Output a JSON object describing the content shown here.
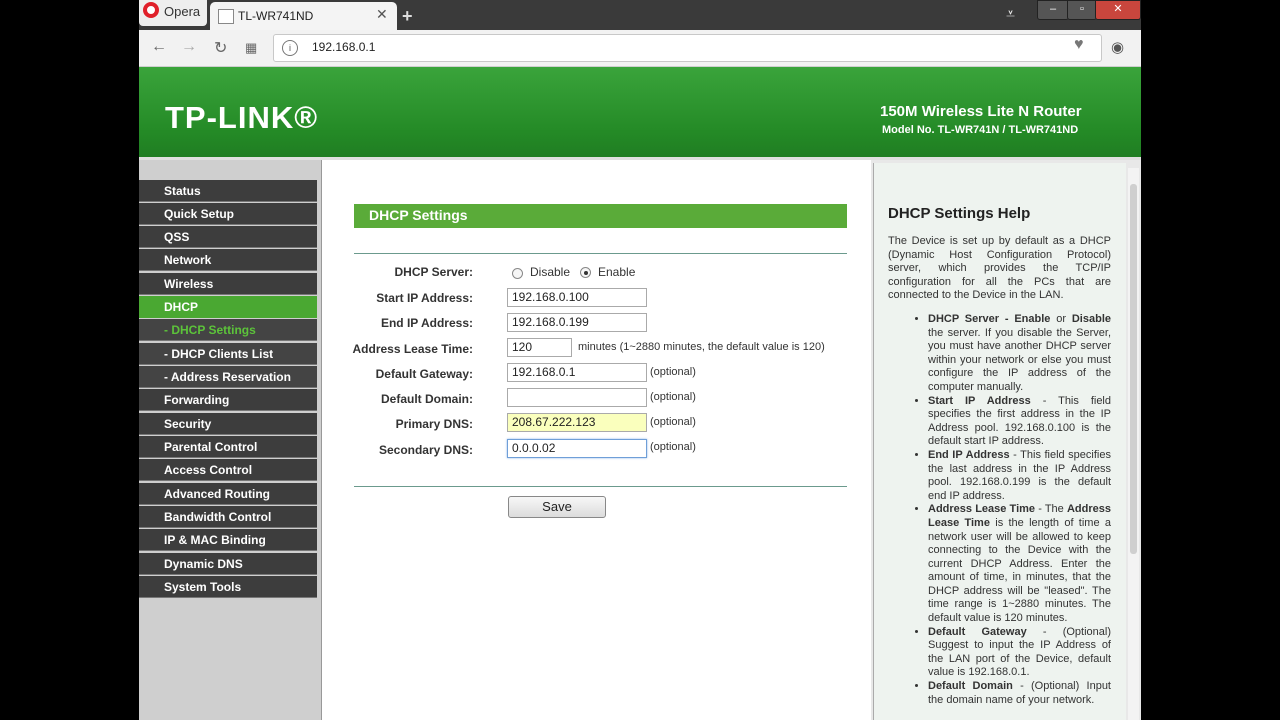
{
  "browser": {
    "opera_label": "Opera",
    "tab_title": "TL-WR741ND",
    "url": "192.168.0.1"
  },
  "header": {
    "logo": "TP-LINK®",
    "product": "150M Wireless Lite N Router",
    "model": "Model No. TL-WR741N / TL-WR741ND"
  },
  "sidebar": {
    "items": [
      {
        "label": "Status"
      },
      {
        "label": "Quick Setup"
      },
      {
        "label": "QSS"
      },
      {
        "label": "Network"
      },
      {
        "label": "Wireless"
      },
      {
        "label": "DHCP"
      },
      {
        "label": "- DHCP Settings"
      },
      {
        "label": "- DHCP Clients List"
      },
      {
        "label": "- Address Reservation"
      },
      {
        "label": "Forwarding"
      },
      {
        "label": "Security"
      },
      {
        "label": "Parental Control"
      },
      {
        "label": "Access Control"
      },
      {
        "label": "Advanced Routing"
      },
      {
        "label": "Bandwidth Control"
      },
      {
        "label": "IP & MAC Binding"
      },
      {
        "label": "Dynamic DNS"
      },
      {
        "label": "System Tools"
      }
    ]
  },
  "main": {
    "title": "DHCP Settings",
    "dhcp_server_label": "DHCP Server:",
    "disable_label": "Disable",
    "enable_label": "Enable",
    "start_ip_label": "Start IP Address:",
    "start_ip_value": "192.168.0.100",
    "end_ip_label": "End IP Address:",
    "end_ip_value": "192.168.0.199",
    "lease_label": "Address Lease Time:",
    "lease_value": "120",
    "lease_hint": "minutes (1~2880 minutes, the default value is 120)",
    "gateway_label": "Default Gateway:",
    "gateway_value": "192.168.0.1",
    "domain_label": "Default Domain:",
    "domain_value": "",
    "primary_dns_label": "Primary DNS:",
    "primary_dns_value": "208.67.222.123",
    "secondary_dns_label": "Secondary DNS:",
    "secondary_dns_value": "0.0.0.02",
    "optional": "(optional)",
    "save_label": "Save"
  },
  "help": {
    "title": "DHCP Settings Help",
    "intro": "The Device is set up by default as a DHCP (Dynamic Host Configuration Protocol) server, which provides the TCP/IP configuration for all the PCs that are connected to the Device in the LAN.",
    "items": [
      {
        "term": "DHCP Server - Enable",
        "text": " or ",
        "term2": "Disable",
        "rest": " the server. If you disable the Server, you must have another DHCP server within your network or else you must configure the IP address of the computer manually."
      },
      {
        "term": "Start IP Address",
        "rest": " - This field specifies the first address in the IP Address pool. 192.168.0.100 is the default start IP address."
      },
      {
        "term": "End IP Address",
        "rest": " - This field specifies the last address in the IP Address pool. 192.168.0.199 is the default end IP address."
      },
      {
        "term": "Address Lease Time",
        "rest": " - The ",
        "term2": "Address Lease Time",
        "rest2": " is the length of time a network user will be allowed to keep connecting to the Device with the current DHCP Address. Enter the amount of time, in minutes, that the DHCP address will be \"leased\". The time range is 1~2880 minutes. The default value is 120 minutes."
      },
      {
        "term": "Default Gateway",
        "rest": " - (Optional) Suggest to input the IP Address of the LAN port of the Device, default value is 192.168.0.1."
      },
      {
        "term": "Default Domain",
        "rest": " - (Optional) Input the domain name of your network."
      }
    ]
  },
  "colors": {
    "brand_green": "#3aa43b",
    "title_green": "#5aab39",
    "active_nav": "#4aa832",
    "sidebar_dark": "#3d3d3d"
  }
}
